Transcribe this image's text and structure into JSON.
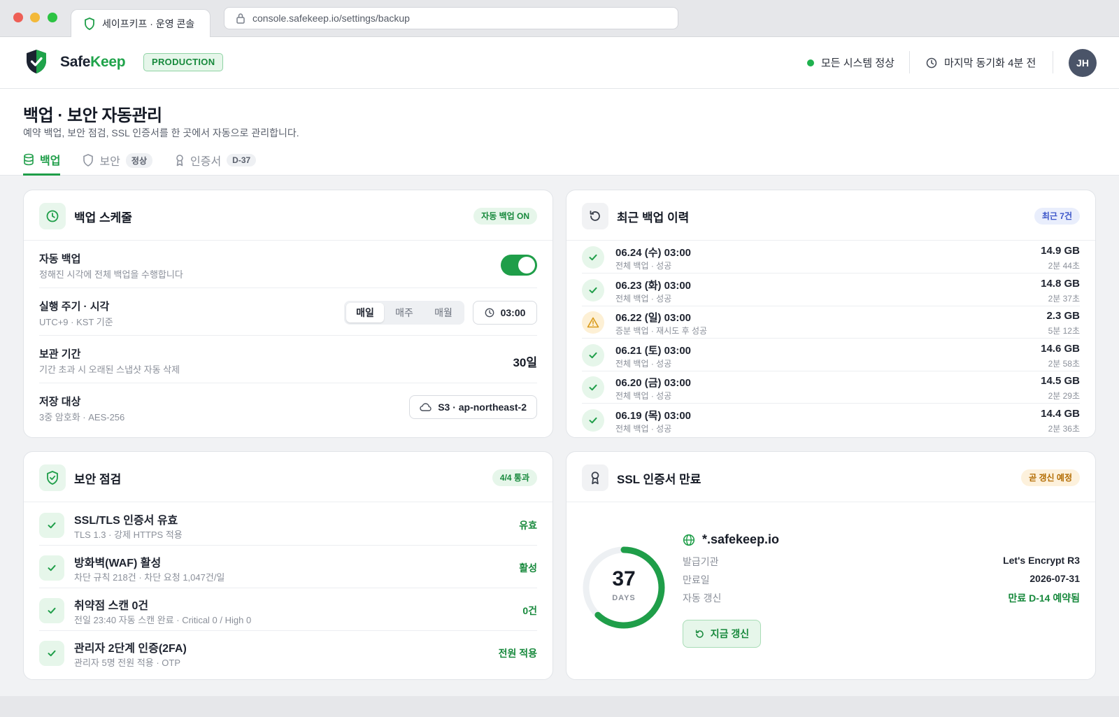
{
  "browser": {
    "tab_title": "세이프키프 · 운영 콘솔",
    "url": "console.safekeep.io/settings/backup"
  },
  "header": {
    "brand_part1": "Safe",
    "brand_part2": "Keep",
    "env_badge": "PRODUCTION",
    "system_status": "모든 시스템 정상",
    "last_sync": "마지막 동기화 4분 전",
    "avatar_initials": "JH"
  },
  "page": {
    "title": "백업 · 보안 자동관리",
    "subtitle": "예약 백업, 보안 점검, SSL 인증서를 한 곳에서 자동으로 관리합니다.",
    "tabs": [
      {
        "label": "백업",
        "badge": ""
      },
      {
        "label": "보안",
        "badge": "정상"
      },
      {
        "label": "인증서",
        "badge": "D-37"
      }
    ]
  },
  "schedule": {
    "title": "백업 스케줄",
    "badge": "자동 백업 ON",
    "auto_backup": {
      "label": "자동 백업",
      "hint": "정해진 시각에 전체 백업을 수행합니다",
      "enabled": true
    },
    "cycle": {
      "label": "실행 주기 · 시각",
      "hint": "UTC+9 · KST 기준",
      "options": [
        "매일",
        "매주",
        "매월"
      ],
      "selected": "매일",
      "time": "03:00"
    },
    "retention": {
      "label": "보관 기간",
      "hint": "기간 초과 시 오래된 스냅샷 자동 삭제",
      "value": "30일"
    },
    "target": {
      "label": "저장 대상",
      "hint": "3중 암호화 · AES-256",
      "value": "S3 · ap-northeast-2"
    }
  },
  "history": {
    "title": "최근 백업 이력",
    "badge": "최근 7건",
    "items": [
      {
        "date": "06.24 (수) 03:00",
        "desc": "전체 백업 · 성공",
        "size": "14.9 GB",
        "duration": "2분 44초",
        "status": "ok"
      },
      {
        "date": "06.23 (화) 03:00",
        "desc": "전체 백업 · 성공",
        "size": "14.8 GB",
        "duration": "2분 37초",
        "status": "ok"
      },
      {
        "date": "06.22 (일) 03:00",
        "desc": "증분 백업 · 재시도 후 성공",
        "size": "2.3 GB",
        "duration": "5분 12초",
        "status": "warn"
      },
      {
        "date": "06.21 (토) 03:00",
        "desc": "전체 백업 · 성공",
        "size": "14.6 GB",
        "duration": "2분 58초",
        "status": "ok"
      },
      {
        "date": "06.20 (금) 03:00",
        "desc": "전체 백업 · 성공",
        "size": "14.5 GB",
        "duration": "2분 29초",
        "status": "ok"
      },
      {
        "date": "06.19 (목) 03:00",
        "desc": "전체 백업 · 성공",
        "size": "14.4 GB",
        "duration": "2분 36초",
        "status": "ok"
      }
    ]
  },
  "security": {
    "title": "보안 점검",
    "badge": "4/4 통과",
    "items": [
      {
        "title": "SSL/TLS 인증서 유효",
        "desc": "TLS 1.3 · 강제 HTTPS 적용",
        "status": "유효"
      },
      {
        "title": "방화벽(WAF) 활성",
        "desc": "차단 규칙 218건 · 차단 요청 1,047건/일",
        "status": "활성"
      },
      {
        "title": "취약점 스캔 0건",
        "desc": "전일 23:40 자동 스캔 완료 · Critical 0 / High 0",
        "status": "0건"
      },
      {
        "title": "관리자 2단계 인증(2FA)",
        "desc": "관리자 5명 전원 적용 · OTP",
        "status": "전원 적용"
      }
    ]
  },
  "ssl": {
    "title": "SSL 인증서 만료",
    "badge": "곧 갱신 예정",
    "days_left": "37",
    "days_label": "DAYS",
    "ring_fraction": 0.62,
    "domain": "*.safekeep.io",
    "issuer_label": "발급기관",
    "issuer": "Let's Encrypt R3",
    "expiry_label": "만료일",
    "expiry": "2026-07-31",
    "renew_label": "자동 갱신",
    "renew_status": "만료 D-14 예약됨",
    "renew_button": "지금 갱신"
  },
  "colors": {
    "accent": "#1f9e49",
    "warning": "#e0a526",
    "info": "#3b55c9"
  }
}
